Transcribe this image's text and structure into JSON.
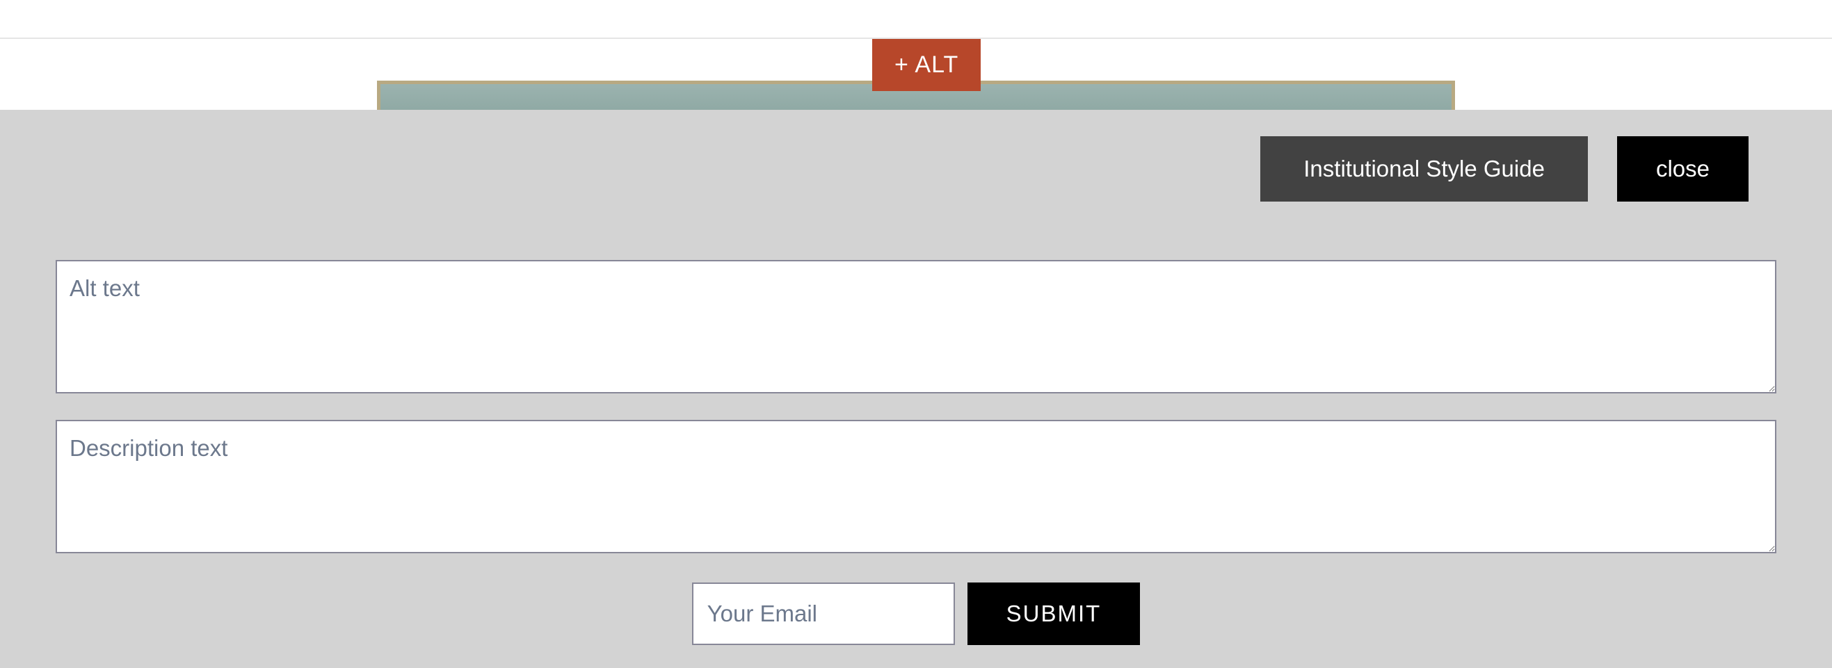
{
  "header": {
    "alt_tag_label": "+ ALT"
  },
  "panel": {
    "style_guide_label": "Institutional Style Guide",
    "close_label": "close",
    "alt_text_placeholder": "Alt text",
    "alt_text_value": "",
    "description_placeholder": "Description text",
    "description_value": "",
    "email_placeholder": "Your Email",
    "email_value": "",
    "submit_label": "SUBMIT"
  },
  "colors": {
    "alt_tag_bg": "#B7472A",
    "panel_bg": "#d3d3d3",
    "style_guide_bg": "#424242",
    "close_bg": "#000000",
    "submit_bg": "#000000",
    "input_border": "#878797",
    "placeholder": "#6c788c"
  }
}
